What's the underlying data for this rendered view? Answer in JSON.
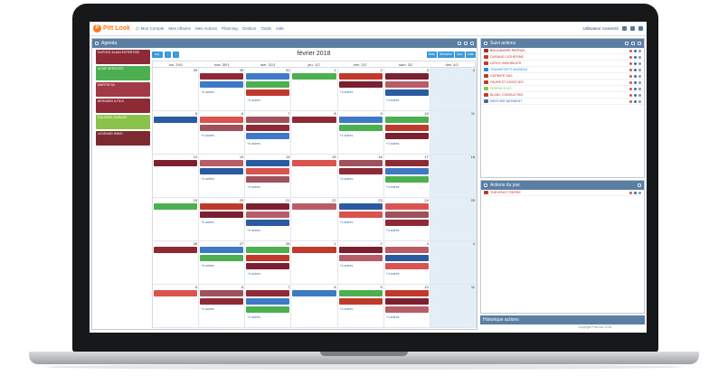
{
  "app": {
    "name": "Pitt Look",
    "user_label": "Utilisateur connecté",
    "nav": [
      "Mon Compte",
      "Mes Affaires",
      "Mes Actions",
      "Planning",
      "Gestion",
      "Outils",
      "Aide"
    ]
  },
  "agenda": {
    "title": "Agenda",
    "month_title": "février 2018",
    "today_btn": "auj.",
    "views": [
      "Mois",
      "Semaine",
      "Jour",
      "Liste"
    ],
    "days": [
      "lun. 29/1",
      "mar. 30/1",
      "mer. 31/1",
      "jeu. 1/2",
      "ven. 2/2",
      "sam. 3/2",
      "dim. 4/2"
    ],
    "weeks": [
      {
        "nums": [
          "29",
          "30",
          "31",
          "1",
          "2",
          "3",
          "4"
        ]
      },
      {
        "nums": [
          "5",
          "6",
          "7",
          "8",
          "9",
          "10",
          "11"
        ]
      },
      {
        "nums": [
          "12",
          "13",
          "14",
          "15",
          "16",
          "17",
          "18"
        ]
      },
      {
        "nums": [
          "19",
          "20",
          "21",
          "22",
          "23",
          "24",
          "25"
        ]
      },
      {
        "nums": [
          "26",
          "27",
          "28",
          "1",
          "2",
          "3",
          "4"
        ]
      },
      {
        "nums": [
          "5",
          "6",
          "7",
          "8",
          "9",
          "10",
          "11"
        ]
      }
    ],
    "more_label": "+4 autres"
  },
  "sidebar_items": [
    {
      "text": "DUPONT ALAIN EXPERTISE",
      "color": "#8e2a36"
    },
    {
      "text": "ACME SERVICES",
      "color": "#4caf50"
    },
    {
      "text": "MARTIN SA",
      "color": "#a23a46"
    },
    {
      "text": "BERNARD & FILS",
      "color": "#8e2a36"
    },
    {
      "text": "ROUSSEL GARAGE",
      "color": "#8bc34a"
    },
    {
      "text": "LEGRAND IMMO",
      "color": "#7c2a30"
    }
  ],
  "actions_panel": {
    "title": "Suivi actions",
    "rows": [
      {
        "text": "BOULANGER PATRICK",
        "color": "#a52a2a"
      },
      {
        "text": "DURAND CATHERINE",
        "color": "#c0392b"
      },
      {
        "text": "LEROY IMMOBILIER",
        "color": "#c0392b"
      },
      {
        "text": "TRANSPORTS MOREAU",
        "color": "#2e86de"
      },
      {
        "text": "GARNIER SAS",
        "color": "#c0392b"
      },
      {
        "text": "FAURE ET ASSOCIES",
        "color": "#c0392b"
      },
      {
        "text": "PERRIN ELEC",
        "color": "#8bc34a"
      },
      {
        "text": "BLANC CONSULTING",
        "color": "#c0392b"
      },
      {
        "text": "MERCIER BATIMENT",
        "color": "#3a6fa8"
      }
    ]
  },
  "prospect_panel": {
    "title": "Actions du jour",
    "rows": [
      {
        "text": "THEVENOT PIERRE",
        "color": "#c0392b"
      }
    ]
  },
  "bottom_panel": {
    "title": "Historique actions"
  },
  "footer": "Copyright PittLook 2018"
}
